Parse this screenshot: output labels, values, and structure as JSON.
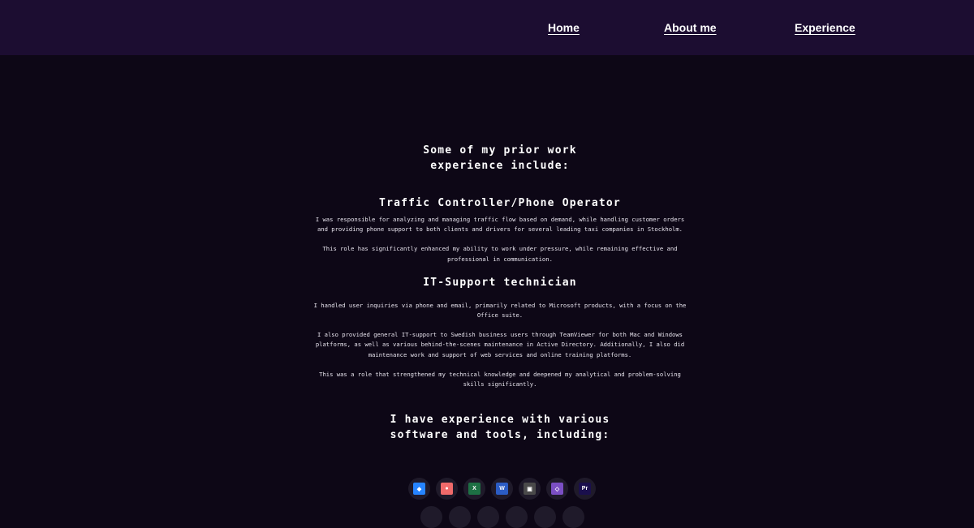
{
  "nav": {
    "home": "Home",
    "about": "About me",
    "experience": "Experience"
  },
  "main": {
    "heading": "Some of my prior work experience include:",
    "roles": [
      {
        "title": "Traffic Controller/Phone Operator",
        "paragraphs": [
          "I was responsible for analyzing and managing traffic flow based on demand, while handling customer orders and providing phone support to both clients and drivers for several leading taxi companies in Stockholm.",
          "This role has significantly enhanced my ability to work under pressure, while remaining effective and professional in communication."
        ]
      },
      {
        "title": "IT-Support technician",
        "paragraphs": [
          "I handled user inquiries via phone and email, primarily related to Microsoft products, with a focus on the Office suite.",
          "I also provided general IT-support to Swedish business users through TeamViewer for both Mac and Windows platforms, as well as various behind-the-scenes maintenance in Active Directory. Additionally, I also did maintenance work and support of web services and online training platforms.",
          "This was a role that strengthened my technical knowledge and deepened my analytical and problem-solving skills significantly."
        ]
      }
    ],
    "tools_heading": "I have experience with various software and tools, including:"
  },
  "tools": [
    {
      "icon": "jira-icon",
      "color": "#2684ff",
      "glyph": "◆"
    },
    {
      "icon": "asana-icon",
      "color": "#f06a6a",
      "glyph": "●"
    },
    {
      "icon": "excel-icon",
      "color": "#1d7044",
      "glyph": "X"
    },
    {
      "icon": "word-icon",
      "color": "#2b5cc4",
      "glyph": "W"
    },
    {
      "icon": "virtualbox-icon",
      "color": "#4a4a4a",
      "glyph": "▣"
    },
    {
      "icon": "visual-studio-icon",
      "color": "#7b4fc4",
      "glyph": "◇"
    },
    {
      "icon": "premiere-pro-icon",
      "color": "#1a0f4d",
      "glyph": "Pr"
    }
  ]
}
